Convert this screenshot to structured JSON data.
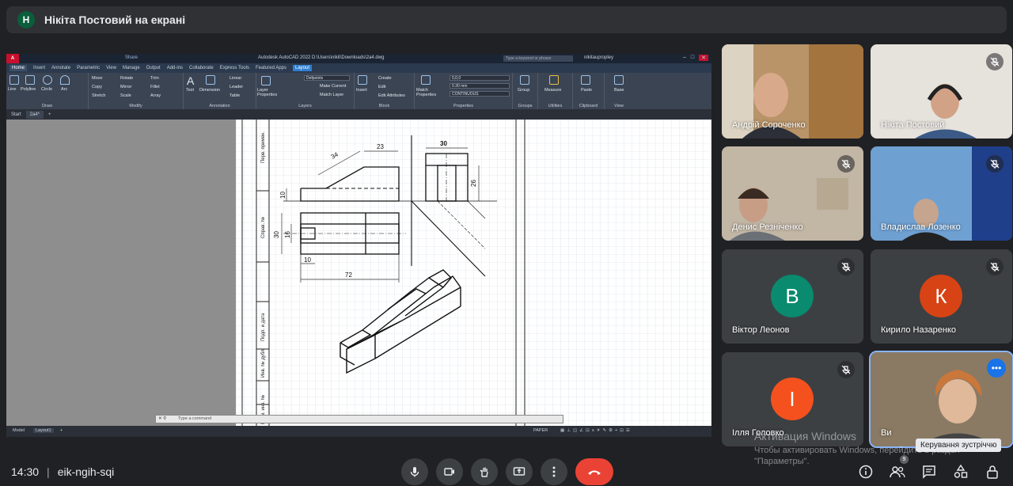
{
  "presenter": {
    "initial": "Н",
    "title": "Нікіта Постовий на екрані"
  },
  "autocad": {
    "logo": "A CAD",
    "share": "Share",
    "app_title": "Autodesk AutoCAD 2022   D:\\Users\\nikit\\Downloads\\2a4.dwg",
    "search_placeholder": "Type a keyword or phrase",
    "user": "nikitaupropley",
    "ribbon_tabs": [
      "Home",
      "Insert",
      "Annotate",
      "Parametric",
      "View",
      "Manage",
      "Output",
      "Add-ins",
      "Collaborate",
      "Express Tools",
      "Featured Apps",
      "Layout"
    ],
    "groups": {
      "draw": "Draw",
      "modify": "Modify",
      "annotation": "Annotation",
      "layers": "Layers",
      "block": "Block",
      "properties": "Properties",
      "groups": "Groups",
      "utilities": "Utilities",
      "clipboard": "Clipboard",
      "view": "View"
    },
    "tools": {
      "line": "Line",
      "polyline": "Polyline",
      "circle": "Circle",
      "arc": "Arc",
      "move": "Move",
      "rotate": "Rotate",
      "trim": "Trim",
      "copy": "Copy",
      "mirror": "Mirror",
      "fillet": "Fillet",
      "stretch": "Stretch",
      "scale": "Scale",
      "array": "Array",
      "text": "Text",
      "dimension": "Dimension",
      "linear": "Linear",
      "leader": "Leader",
      "table": "Table",
      "layer_properties": "Layer Properties",
      "defpoints": "Defpoints",
      "make_current": "Make Current",
      "match_layer": "Match Layer",
      "insert": "Insert",
      "create": "Create",
      "edit": "Edit",
      "edit_attributes": "Edit Attributes",
      "match_properties": "Match Properties",
      "color": "0,0,0",
      "lineweight": "0.30 mm",
      "linetype": "CONTINUOUS",
      "group": "Group",
      "measure": "Measure",
      "paste": "Paste",
      "base": "Base"
    },
    "doc_tabs": [
      "Start",
      "2a4*"
    ],
    "layout_tabs": [
      "Model",
      "Layout1"
    ],
    "command_placeholder": "Type a command",
    "status": {
      "paper": "PAPER"
    }
  },
  "drawing": {
    "dims": {
      "d34": "34",
      "d23": "23",
      "d30": "30",
      "d26": "26",
      "d10a": "10",
      "d30v": "30",
      "d16": "16",
      "d10b": "10",
      "d72": "72"
    },
    "frame_labels": [
      "Перв. примен.",
      "Справ. №",
      "Подп. и дата",
      "Инв. № дубл.",
      "Взам. инв. №"
    ]
  },
  "participants": [
    {
      "name": "Андрій Сороченко",
      "type": "video",
      "muted": false
    },
    {
      "name": "Нікіта Постовий",
      "type": "video",
      "muted": true
    },
    {
      "name": "Денис Резніченко",
      "type": "video",
      "muted": true
    },
    {
      "name": "Владислав Лозенко",
      "type": "video",
      "muted": true
    },
    {
      "name": "Віктор Леонов",
      "type": "avatar",
      "initial": "В",
      "color": "#0a8a6e",
      "muted": true
    },
    {
      "name": "Кирило Назаренко",
      "type": "avatar",
      "initial": "К",
      "color": "#d84315",
      "muted": true
    },
    {
      "name": "Ілля Головко",
      "type": "avatar",
      "initial": "І",
      "color": "#f4511e",
      "muted": true
    },
    {
      "name": "Ви",
      "type": "video",
      "muted": false
    }
  ],
  "tooltip": "Керування зустріччю",
  "watermark": {
    "line1": "Активация Windows",
    "line2": "Чтобы активировать Windows, перейдите в раздел \"Параметры\"."
  },
  "meeting": {
    "time": "14:30",
    "sep": "|",
    "code": "eik-ngih-sqi",
    "participants_count": "9"
  },
  "colors": {
    "hangup": "#ea4335",
    "accent": "#1a73e8"
  }
}
